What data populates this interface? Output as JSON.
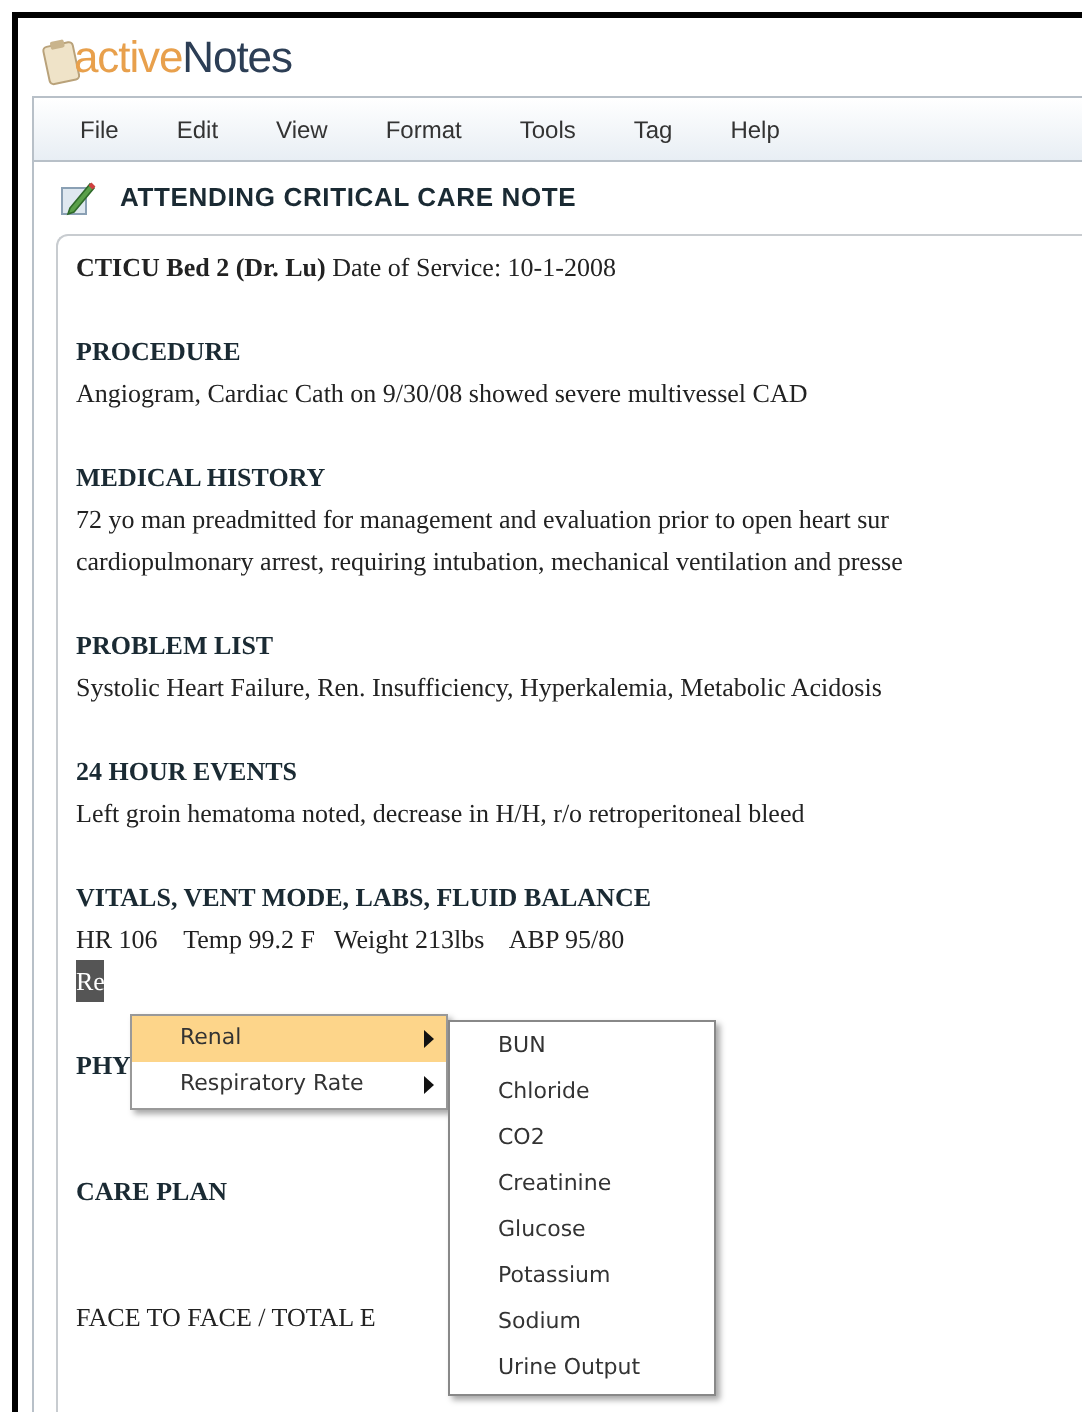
{
  "logo": {
    "part1": "active",
    "part2": "Notes"
  },
  "menu_bar": [
    "File",
    "Edit",
    "View",
    "Format",
    "Tools",
    "Tag",
    "Help"
  ],
  "note": {
    "title": "ATTENDING CRITICAL CARE NOTE",
    "header": "**CTICU Bed 2 (Dr. Lu)** Date of Service: 10-1-2008",
    "sections": [
      {
        "heading": "PROCEDURE",
        "bold": true,
        "lines": [
          {
            "text": "Angiogram, Cardiac Cath on 9/30/08 showed severe multivessel CAD",
            "highlighted": false
          }
        ]
      },
      {
        "heading": "MEDICAL HISTORY",
        "bold": true,
        "lines": [
          {
            "text": "72 yo man preadmitted for management and evaluation prior to open heart sur",
            "highlighted": false
          },
          {
            "text": "cardiopulmonary arrest, requiring intubation, mechanical ventilation and presse",
            "highlighted": false
          }
        ]
      },
      {
        "heading": "PROBLEM LIST",
        "bold": true,
        "lines": [
          {
            "text": "Systolic Heart Failure, Ren. Insufficiency, Hyperkalemia, Metabolic Acidosis",
            "highlighted": false
          }
        ]
      },
      {
        "heading": "24 HOUR EVENTS",
        "bold": true,
        "lines": [
          {
            "text": "Left groin hematoma noted, decrease in H/H, r/o retroperitoneal bleed",
            "highlighted": false
          }
        ]
      },
      {
        "heading": "VITALS, VENT MODE, LABS, FLUID BALANCE",
        "bold": true,
        "lines": [
          {
            "text": "HR 106    Temp 99.2 F   Weight 213lbs    ABP 95/80",
            "highlighted": false
          },
          {
            "text": "Re",
            "highlighted": true
          }
        ]
      },
      {
        "heading": "PHY",
        "bold": true
      },
      {
        "heading": "CARE PLAN",
        "bold": true
      },
      {
        "heading": "FACE TO FACE / TOTAL E",
        "bold": false
      }
    ]
  },
  "context_menu": {
    "items": [
      {
        "label": "Renal",
        "selected": true,
        "submenu": true
      },
      {
        "label": "Respiratory Rate",
        "selected": false,
        "submenu": true
      }
    ],
    "submenu": [
      "BUN",
      "Chloride",
      "CO2",
      "Creatinine",
      "Glucose",
      "Potassium",
      "Sodium",
      "Urine Output"
    ]
  }
}
